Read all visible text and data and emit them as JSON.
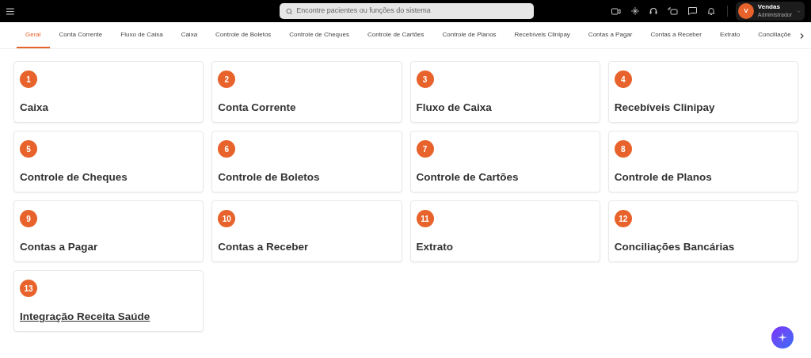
{
  "topbar": {
    "search": {
      "placeholder": "Encontre pacientes ou funções do sistema"
    },
    "user": {
      "initial": "V",
      "name": "Vendas",
      "role": "Administrador"
    }
  },
  "tabs": [
    {
      "label": "Geral",
      "selected": true
    },
    {
      "label": "Conta Corrente",
      "selected": false
    },
    {
      "label": "Fluxo de Caixa",
      "selected": false
    },
    {
      "label": "Caixa",
      "selected": false
    },
    {
      "label": "Controle de Boletos",
      "selected": false
    },
    {
      "label": "Controle de Cheques",
      "selected": false
    },
    {
      "label": "Controle de Cartões",
      "selected": false
    },
    {
      "label": "Controle de Planos",
      "selected": false
    },
    {
      "label": "Recebíveis Clinipay",
      "selected": false
    },
    {
      "label": "Contas a Pagar",
      "selected": false
    },
    {
      "label": "Contas a Receber",
      "selected": false
    },
    {
      "label": "Extrato",
      "selected": false
    },
    {
      "label": "Conciliaçõe",
      "selected": false
    }
  ],
  "cards": [
    {
      "number": "1",
      "title": "Caixa",
      "hovered": false
    },
    {
      "number": "2",
      "title": "Conta Corrente",
      "hovered": false
    },
    {
      "number": "3",
      "title": "Fluxo de Caixa",
      "hovered": false
    },
    {
      "number": "4",
      "title": "Recebíveis Clinipay",
      "hovered": false
    },
    {
      "number": "5",
      "title": "Controle de Cheques",
      "hovered": false
    },
    {
      "number": "6",
      "title": "Controle de Boletos",
      "hovered": false
    },
    {
      "number": "7",
      "title": "Controle de Cartões",
      "hovered": false
    },
    {
      "number": "8",
      "title": "Controle de Planos",
      "hovered": false
    },
    {
      "number": "9",
      "title": "Contas a Pagar",
      "hovered": false
    },
    {
      "number": "10",
      "title": "Contas a Receber",
      "hovered": false
    },
    {
      "number": "11",
      "title": "Extrato",
      "hovered": false
    },
    {
      "number": "12",
      "title": "Conciliações Bancárias",
      "hovered": false
    },
    {
      "number": "13",
      "title": "Integração Receita Saúde",
      "hovered": true
    }
  ]
}
